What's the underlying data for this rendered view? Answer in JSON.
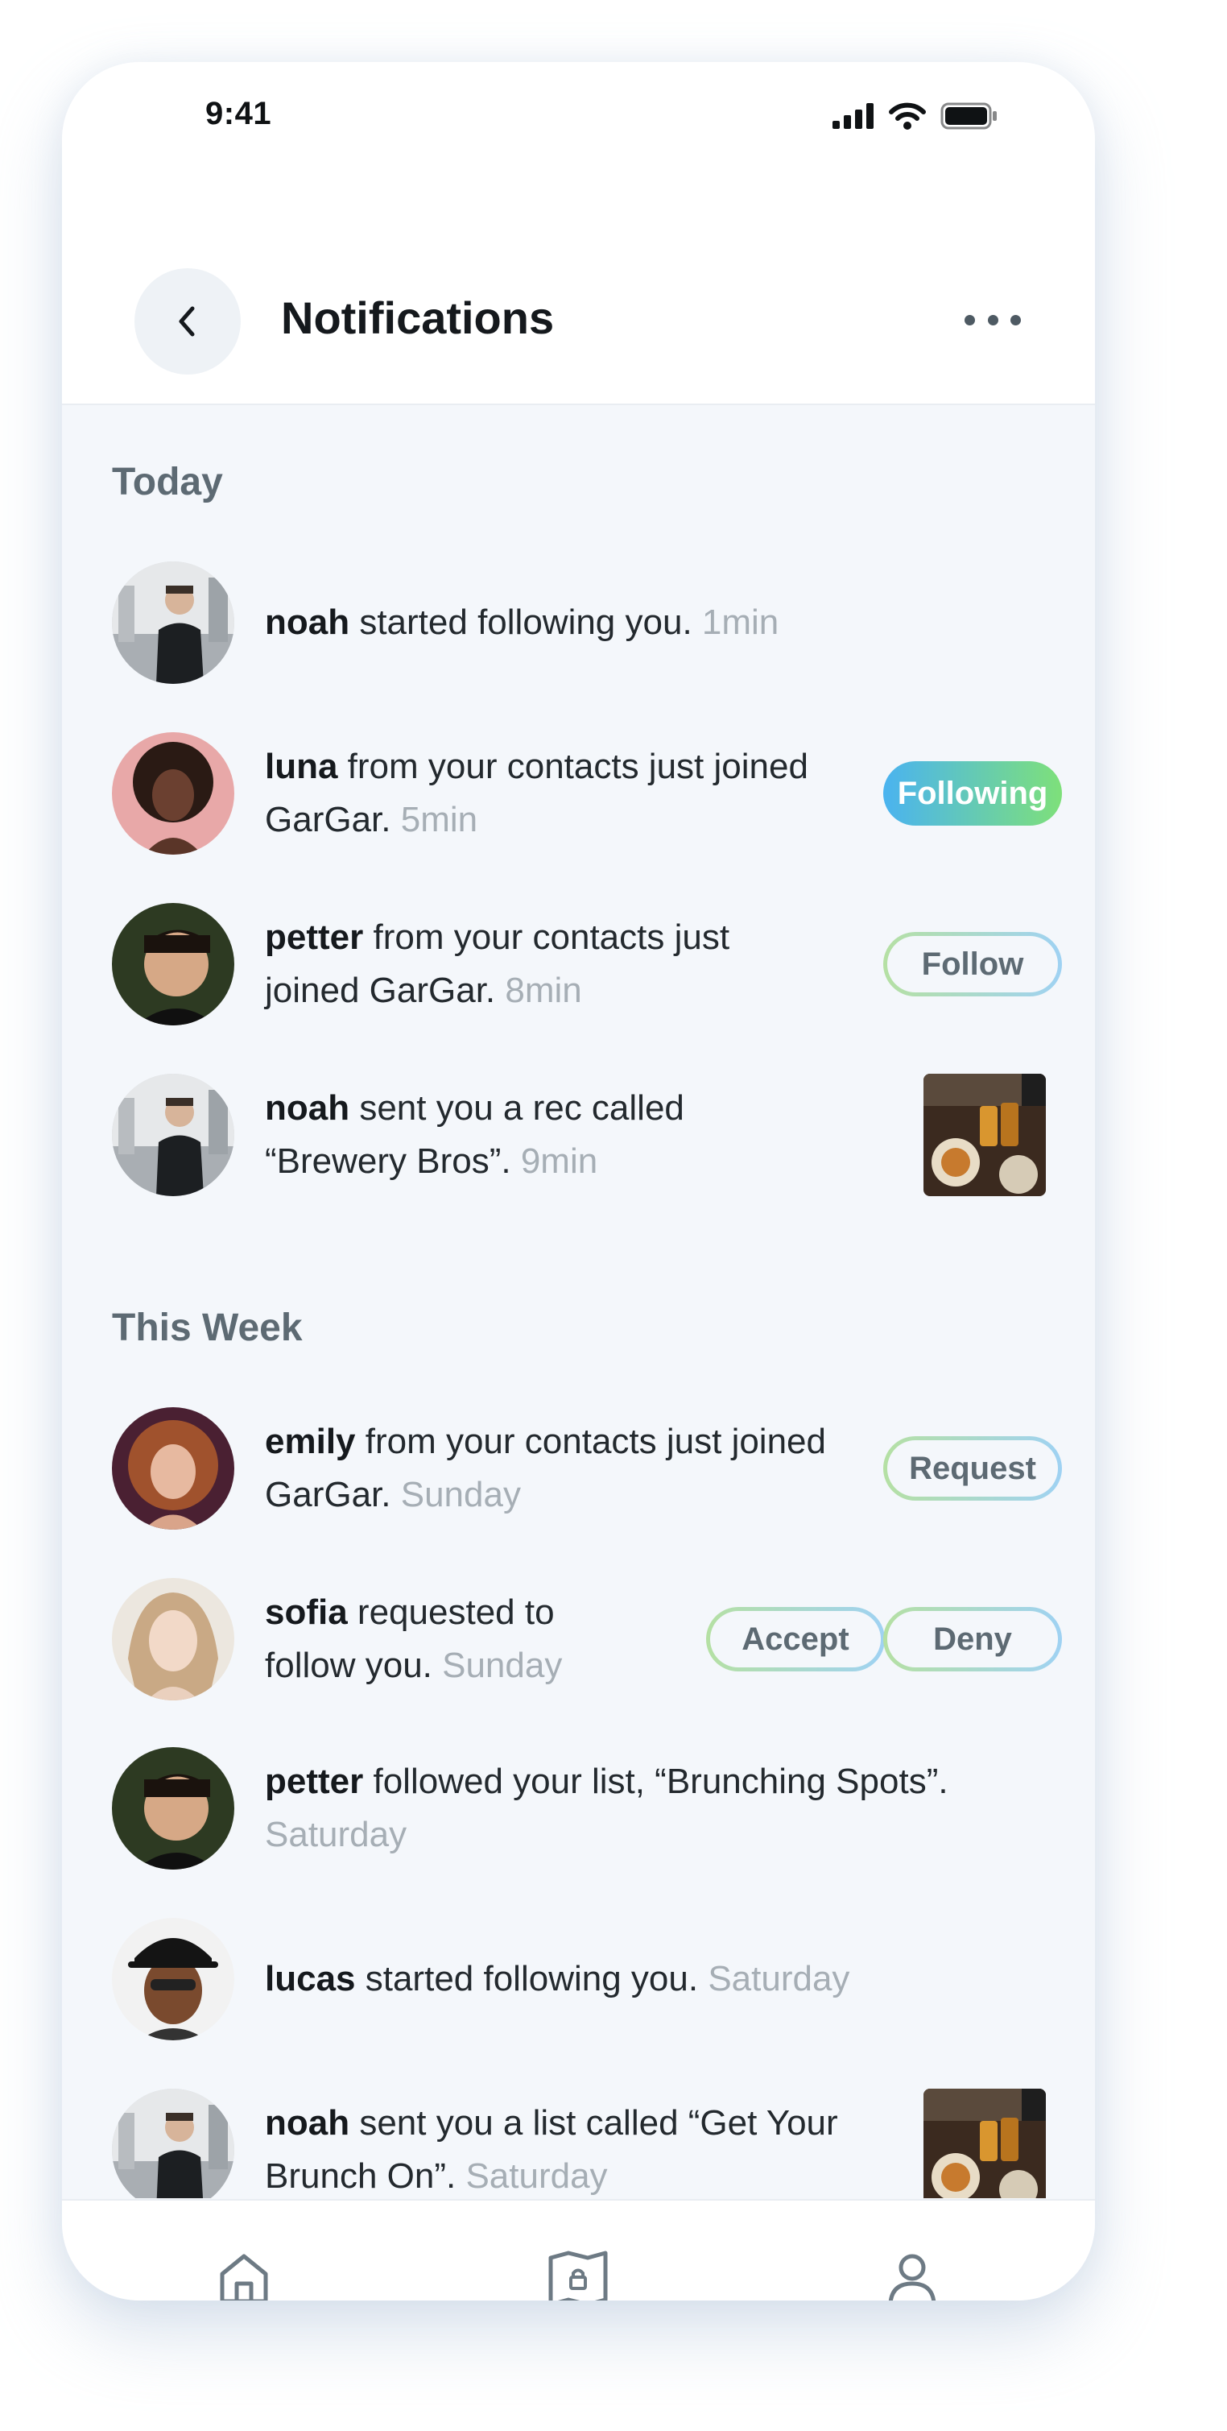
{
  "status_bar": {
    "time": "9:41",
    "icons": [
      "signal-icon",
      "wifi-icon",
      "battery-icon"
    ]
  },
  "header": {
    "title": "Notifications",
    "back_icon": "chevron-left-icon",
    "more_icon": "more-horizontal-icon"
  },
  "sections": {
    "today": "Today",
    "this_week": "This Week"
  },
  "notifications": [
    {
      "user": "noah",
      "text": " started following you. ",
      "time": "1min"
    },
    {
      "user": "luna",
      "text": " from your contacts just joined GarGar. ",
      "time": "5min",
      "action": "Following"
    },
    {
      "user": "petter",
      "text": " from your contacts just joined GarGar. ",
      "time": "8min",
      "action": "Follow"
    },
    {
      "user": "noah",
      "text": " sent you a rec called “Brewery Bros”. ",
      "time": "9min"
    },
    {
      "user": "emily",
      "text": " from your contacts just joined GarGar. ",
      "time": "Sunday",
      "action": "Request"
    },
    {
      "user": "sofia",
      "text": " requested to follow you. ",
      "time": "Sunday",
      "actions": [
        "Accept",
        "Deny"
      ]
    },
    {
      "user": "petter",
      "text": " followed your list, “Brunching Spots”. ",
      "time": "Saturday"
    },
    {
      "user": "lucas",
      "text": " started following you. ",
      "time": "Saturday"
    },
    {
      "user": "noah",
      "text": " sent you a list called “Get Your Brunch On”. ",
      "time": "Saturday"
    }
  ],
  "bottom_nav": {
    "items": [
      "home-icon",
      "map-icon",
      "profile-icon"
    ]
  },
  "colors": {
    "background": "#f4f7fb",
    "following_gradient": [
      "#4ab3f0",
      "#7ee07a"
    ],
    "outline_gradient": [
      "#b5e0a3",
      "#9fd2f3"
    ],
    "muted_text": "#a6aeb5"
  }
}
